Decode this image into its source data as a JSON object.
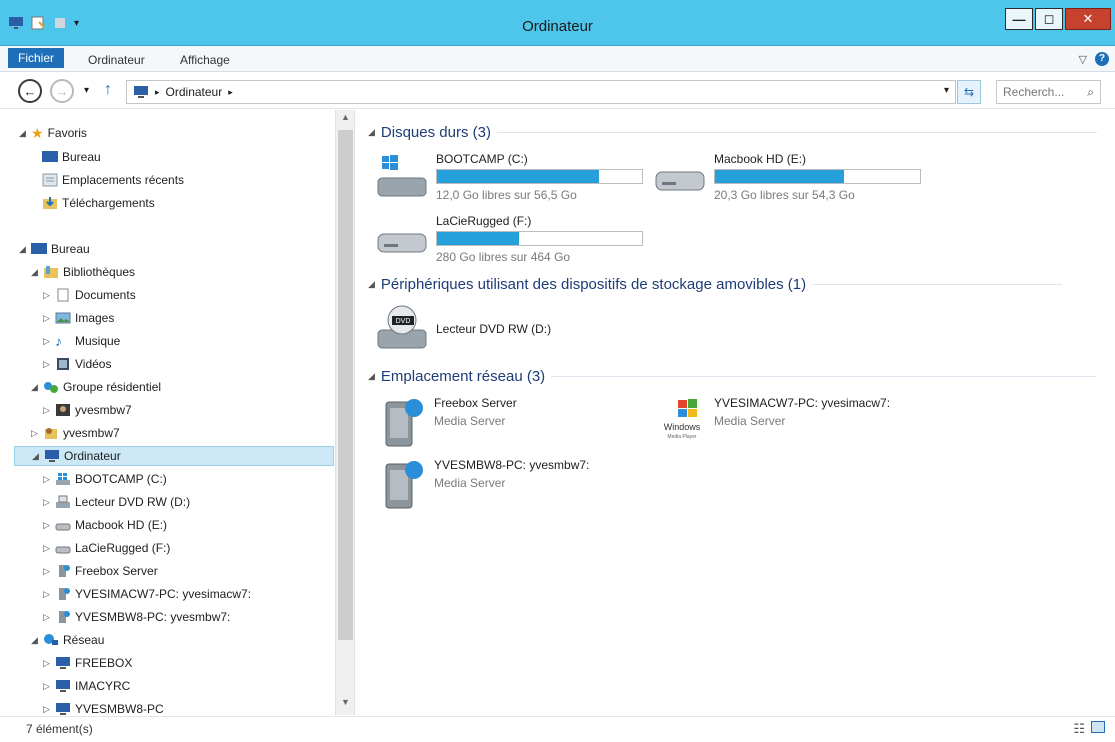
{
  "window": {
    "title": "Ordinateur"
  },
  "ribbon": {
    "tabs": [
      "Fichier",
      "Ordinateur",
      "Affichage"
    ]
  },
  "address": {
    "crumb": "Ordinateur",
    "search_placeholder": "Recherch..."
  },
  "nav": {
    "items": [
      {
        "label": "Favoris",
        "icon": "star-icon"
      },
      {
        "label": "Bureau",
        "icon": "desktop-icon"
      },
      {
        "label": "Emplacements récents",
        "icon": "recent-places-icon"
      },
      {
        "label": "Téléchargements",
        "icon": "downloads-icon"
      },
      {
        "label": "Bureau",
        "icon": "desktop-icon"
      },
      {
        "label": "Bibliothèques",
        "icon": "libraries-icon"
      },
      {
        "label": "Documents",
        "icon": "documents-icon"
      },
      {
        "label": "Images",
        "icon": "images-icon"
      },
      {
        "label": "Musique",
        "icon": "music-icon"
      },
      {
        "label": "Vidéos",
        "icon": "videos-icon"
      },
      {
        "label": "Groupe résidentiel",
        "icon": "homegroup-icon"
      },
      {
        "label": "yvesmbw7",
        "icon": "user-icon"
      },
      {
        "label": "yvesmbw7",
        "icon": "user-folder-icon"
      },
      {
        "label": "Ordinateur",
        "icon": "computer-icon"
      },
      {
        "label": "BOOTCAMP (C:)",
        "icon": "windows-drive-icon"
      },
      {
        "label": "Lecteur DVD RW (D:)",
        "icon": "dvd-drive-icon"
      },
      {
        "label": "Macbook HD (E:)",
        "icon": "drive-icon"
      },
      {
        "label": "LaCieRugged (F:)",
        "icon": "drive-icon"
      },
      {
        "label": "Freebox Server",
        "icon": "media-server-icon"
      },
      {
        "label": "YVESIMACW7-PC: yvesimacw7:",
        "icon": "media-server-icon"
      },
      {
        "label": "YVESMBW8-PC: yvesmbw7:",
        "icon": "media-server-icon"
      },
      {
        "label": "Réseau",
        "icon": "network-icon"
      },
      {
        "label": "FREEBOX",
        "icon": "network-computer-icon"
      },
      {
        "label": "IMACYRC",
        "icon": "network-computer-icon"
      },
      {
        "label": "YVESMBW8-PC",
        "icon": "network-computer-icon"
      }
    ]
  },
  "groups": {
    "hard_drives": "Disques durs (3)",
    "removable": "Périphériques utilisant des dispositifs de stockage amovibles (1)",
    "network": "Emplacement réseau (3)"
  },
  "drives": [
    {
      "name": "BOOTCAMP (C:)",
      "free": "12,0 Go libres sur 56,5 Go",
      "used_fraction": 0.79
    },
    {
      "name": "Macbook HD (E:)",
      "free": "20,3 Go libres sur 54,3 Go",
      "used_fraction": 0.63
    },
    {
      "name": "LaCieRugged (F:)",
      "free": "280 Go libres sur 464 Go",
      "used_fraction": 0.4
    }
  ],
  "removable": [
    {
      "name": "Lecteur DVD RW (D:)"
    }
  ],
  "network_locations": [
    {
      "name": "Freebox Server",
      "type": "Media Server"
    },
    {
      "name": "YVESIMACW7-PC: yvesimacw7:",
      "type": "Media Server"
    },
    {
      "name": "YVESMBW8-PC: yvesmbw7:",
      "type": "Media Server"
    }
  ],
  "status": {
    "count": "7 élément(s)"
  },
  "colors": {
    "titlebar": "#4ec6ec",
    "accent": "#1e6fb8",
    "bar_fill": "#26a0da"
  }
}
